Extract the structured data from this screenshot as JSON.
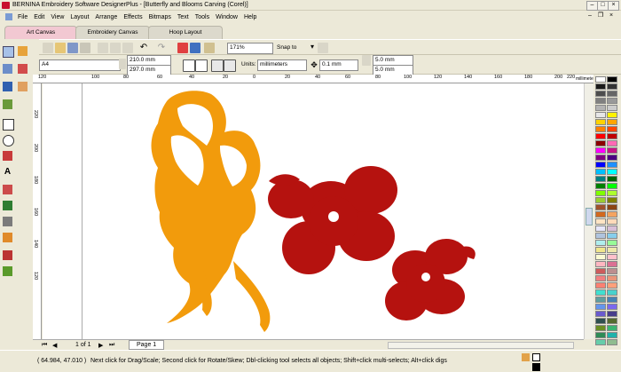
{
  "window": {
    "title": "BERNINA Embroidery Software DesignerPlus - [Butterfly and Blooms Carving (Corel)]"
  },
  "menu": [
    "File",
    "Edit",
    "View",
    "Layout",
    "Arrange",
    "Effects",
    "Bitmaps",
    "Text",
    "Tools",
    "Window",
    "Help"
  ],
  "tabs": [
    "Art Canvas",
    "Embroidery Canvas",
    "Hoop Layout"
  ],
  "toolbar": {
    "zoom": "171%",
    "snap_to": "Snap to"
  },
  "property_bar": {
    "paper_size": "A4",
    "width": "210.0 mm",
    "height": "297.0 mm",
    "units_label": "Units:",
    "units_value": "millimeters",
    "nudge": "0.1 mm",
    "dup_x": "5.0 mm",
    "dup_y": "5.0 mm"
  },
  "ruler": {
    "top_labels": [
      "120",
      "100",
      "80",
      "60",
      "40",
      "20",
      "0",
      "20",
      "40",
      "60",
      "80",
      "100",
      "120",
      "140",
      "160",
      "180",
      "200",
      "220"
    ],
    "unit": "millimeters",
    "left_labels": [
      "220",
      "200",
      "180",
      "160",
      "140",
      "120"
    ]
  },
  "pages": {
    "counter": "1 of 1",
    "tab": "Page 1"
  },
  "status": {
    "coords": "( 64.984, 47.010 )",
    "hint": "Next click for Drag/Scale; Second click for Rotate/Skew; Dbl-clicking tool selects all objects; Shift+click multi-selects; Alt+click digs"
  },
  "colors": {
    "butterfly": "#f29b0c",
    "flower": "#b5120f",
    "tab_active": "#f2c8d2",
    "tab_bg": "#dcd9cc"
  },
  "palette": [
    "#ffffff",
    "#000000",
    "#1a1a1a",
    "#333333",
    "#4d4d4d",
    "#666666",
    "#808080",
    "#999999",
    "#b3b3b3",
    "#cccccc",
    "#e6e6e6",
    "#fff200",
    "#ffd200",
    "#ffa500",
    "#ff7f00",
    "#ff4500",
    "#ff0000",
    "#c00000",
    "#8b0000",
    "#ff69b4",
    "#ff00ff",
    "#c71585",
    "#800080",
    "#4b0082",
    "#0000ff",
    "#1e90ff",
    "#00bfff",
    "#00ffff",
    "#008080",
    "#006400",
    "#008000",
    "#00ff00",
    "#7fff00",
    "#adff2f",
    "#9acd32",
    "#808000",
    "#a0522d",
    "#8b4513",
    "#d2691e",
    "#f4a460",
    "#ffe4c4",
    "#ffdab9",
    "#e6e6fa",
    "#d8bfd8",
    "#b0c4de",
    "#87ceeb",
    "#afeeee",
    "#98fb98",
    "#f0e68c",
    "#eee8aa",
    "#fafad2",
    "#ffc0cb",
    "#ffb6c1",
    "#db7093",
    "#cd5c5c",
    "#bc8f8f",
    "#f08080",
    "#e9967a",
    "#fa8072",
    "#ffa07a",
    "#40e0d0",
    "#48d1cc",
    "#5f9ea0",
    "#4682b4",
    "#6495ed",
    "#7b68ee",
    "#6a5acd",
    "#483d8b",
    "#2f4f4f",
    "#556b2f",
    "#6b8e23",
    "#3cb371",
    "#2e8b57",
    "#20b2aa",
    "#66cdaa",
    "#8fbc8f"
  ]
}
